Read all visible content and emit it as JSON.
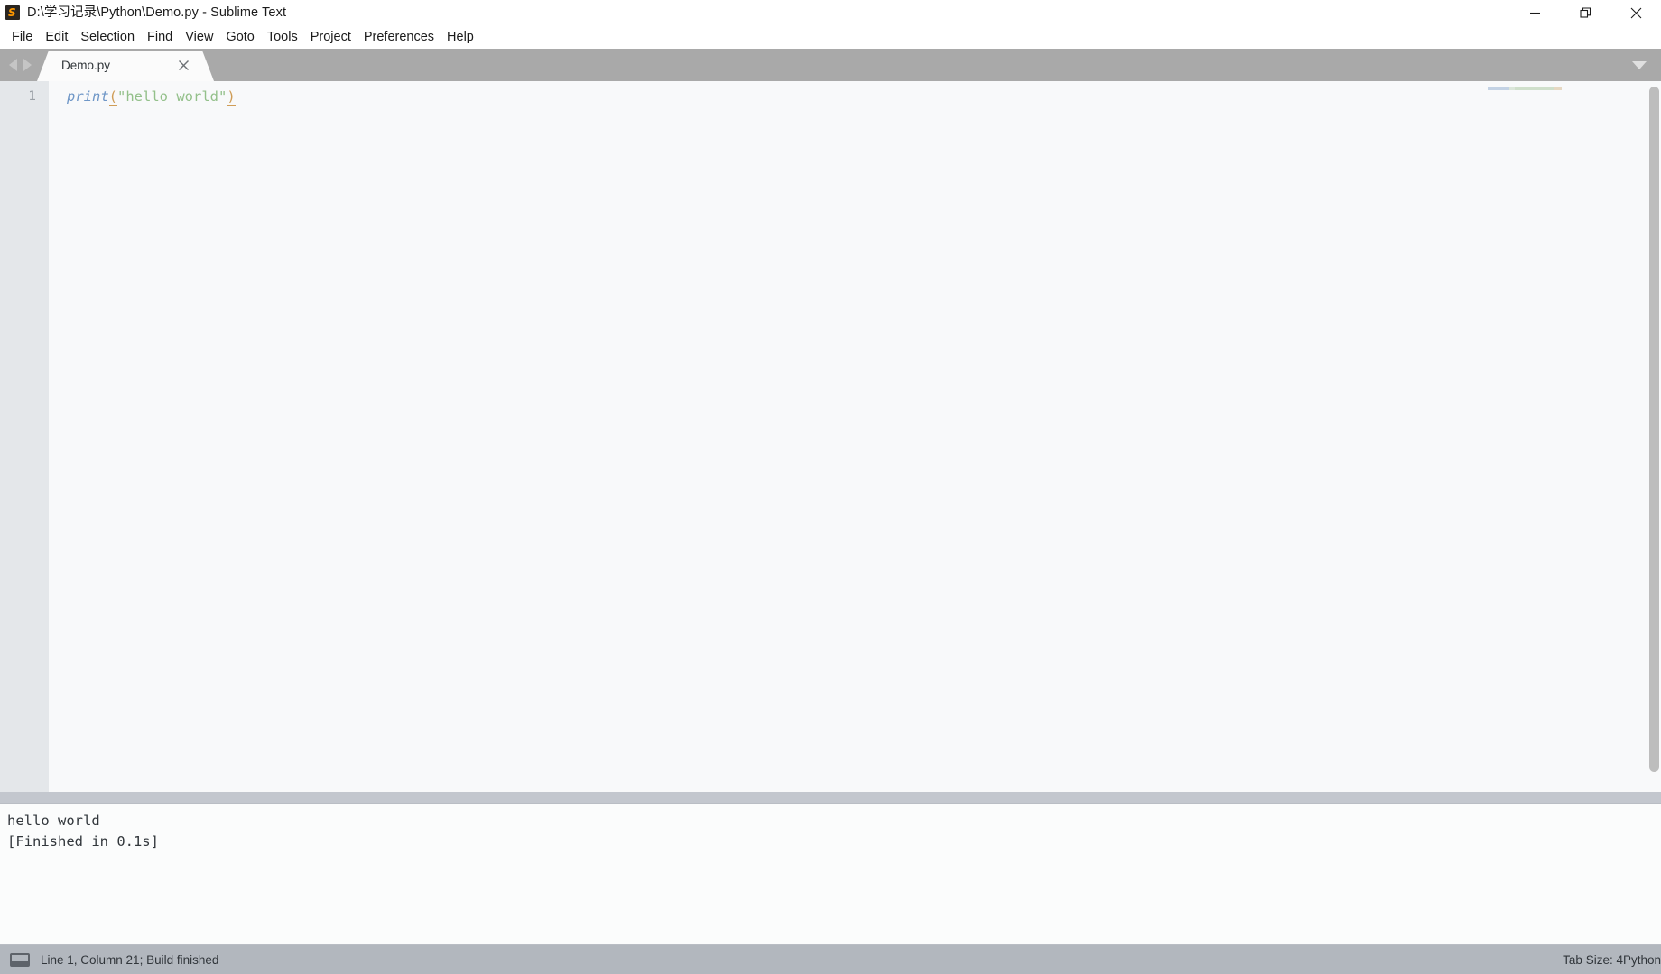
{
  "window": {
    "title": "D:\\学习记录\\Python\\Demo.py - Sublime Text",
    "app_icon": "sublime-logo-icon",
    "logo_glyph": "S",
    "controls": {
      "minimize": "minimize-icon",
      "restore": "restore-icon",
      "close": "close-icon"
    }
  },
  "menubar": {
    "items": [
      {
        "label": "File"
      },
      {
        "label": "Edit"
      },
      {
        "label": "Selection"
      },
      {
        "label": "Find"
      },
      {
        "label": "View"
      },
      {
        "label": "Goto"
      },
      {
        "label": "Tools"
      },
      {
        "label": "Project"
      },
      {
        "label": "Preferences"
      },
      {
        "label": "Help"
      }
    ]
  },
  "tabbar": {
    "nav_back": "arrow-left-icon",
    "nav_forward": "arrow-right-icon",
    "dropdown": "chevron-down-icon",
    "tabs": [
      {
        "label": "Demo.py",
        "close": "×",
        "active": true
      }
    ]
  },
  "editor": {
    "line_numbers": [
      "1"
    ],
    "code": {
      "tokens": [
        {
          "text": "print",
          "type": "function"
        },
        {
          "text": "(",
          "type": "paren"
        },
        {
          "text": "\"hello world\"",
          "type": "string"
        },
        {
          "text": ")",
          "type": "paren"
        }
      ],
      "plain": "print(\"hello world\")"
    },
    "colors": {
      "background": "#f8f9fa",
      "gutter_background": "#e4e7ea",
      "line_number": "#9aa0a6",
      "function": "#6f97c7",
      "paren": "#cf9d57",
      "string": "#93c08a",
      "scrollbar": "#bdbdbd"
    }
  },
  "console": {
    "lines": [
      "hello world",
      "[Finished in 0.1s]"
    ]
  },
  "statusbar": {
    "panel_icon": "console-panel-icon",
    "message": "Line 1, Column 21; Build finished",
    "tab_size": "Tab Size: 4",
    "syntax": "Python",
    "background": "#b2b7be"
  }
}
